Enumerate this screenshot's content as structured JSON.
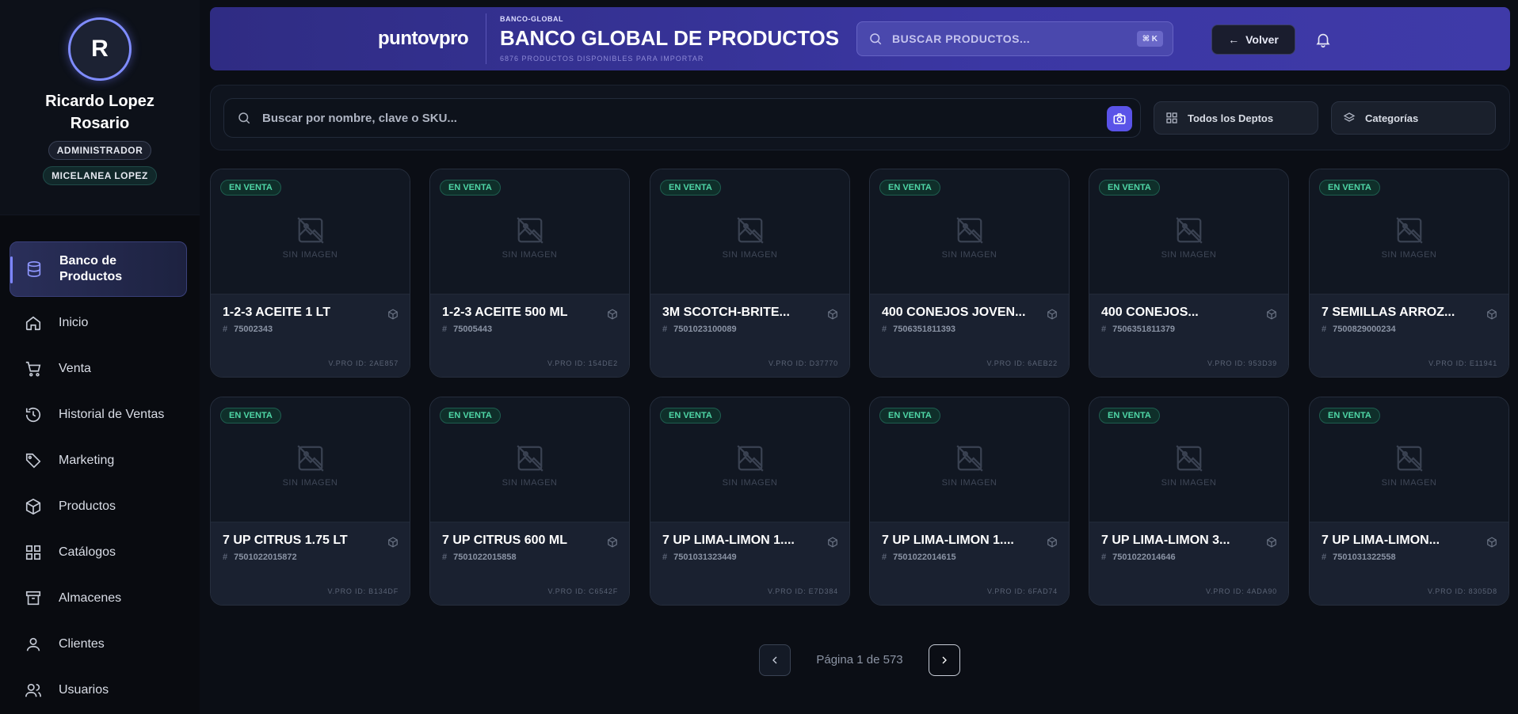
{
  "user": {
    "initial": "R",
    "name": "Ricardo Lopez Rosario",
    "role": "ADMINISTRADOR",
    "store": "MICELANEA LOPEZ"
  },
  "nav": [
    {
      "label": "Banco de Productos",
      "icon": "database-icon",
      "active": true
    },
    {
      "label": "Inicio",
      "icon": "home-icon"
    },
    {
      "label": "Venta",
      "icon": "cart-icon"
    },
    {
      "label": "Historial de Ventas",
      "icon": "history-icon"
    },
    {
      "label": "Marketing",
      "icon": "tag-icon"
    },
    {
      "label": "Productos",
      "icon": "box-icon"
    },
    {
      "label": "Catálogos",
      "icon": "grid-icon"
    },
    {
      "label": "Almacenes",
      "icon": "archive-icon"
    },
    {
      "label": "Clientes",
      "icon": "user-icon"
    },
    {
      "label": "Usuarios",
      "icon": "users-icon"
    }
  ],
  "header": {
    "brand": "puntovpro",
    "breadcrumb": "BANCO-GLOBAL",
    "title": "BANCO GLOBAL DE PRODUCTOS",
    "subtitle": "6876 PRODUCTOS DISPONIBLES PARA IMPORTAR",
    "search_placeholder": "BUSCAR PRODUCTOS...",
    "shortcut": "⌘ K",
    "back_label": "Volver"
  },
  "filters": {
    "search_placeholder": "Buscar por nombre, clave o SKU...",
    "department": "Todos los Deptos",
    "category": "Categorías"
  },
  "placeholder_text": "SIN IMAGEN",
  "products": [
    {
      "status": "EN VENTA",
      "name": "1-2-3 ACEITE 1 LT",
      "sku": "75002343",
      "vpro": "V.PRO ID: 2AE857"
    },
    {
      "status": "EN VENTA",
      "name": "1-2-3 ACEITE 500 ML",
      "sku": "75005443",
      "vpro": "V.PRO ID: 154DE2"
    },
    {
      "status": "EN VENTA",
      "name": "3M SCOTCH-BRITE...",
      "sku": "7501023100089",
      "vpro": "V.PRO ID: D37770"
    },
    {
      "status": "EN VENTA",
      "name": "400 CONEJOS JOVEN...",
      "sku": "7506351811393",
      "vpro": "V.PRO ID: 6AEB22"
    },
    {
      "status": "EN VENTA",
      "name": "400 CONEJOS...",
      "sku": "7506351811379",
      "vpro": "V.PRO ID: 953D39"
    },
    {
      "status": "EN VENTA",
      "name": "7 SEMILLAS ARROZ...",
      "sku": "7500829000234",
      "vpro": "V.PRO ID: E11941"
    },
    {
      "status": "EN VENTA",
      "name": "7 UP CITRUS 1.75 LT",
      "sku": "7501022015872",
      "vpro": "V.PRO ID: B134DF"
    },
    {
      "status": "EN VENTA",
      "name": "7 UP CITRUS 600 ML",
      "sku": "7501022015858",
      "vpro": "V.PRO ID: C6542F"
    },
    {
      "status": "EN VENTA",
      "name": "7 UP LIMA-LIMON 1....",
      "sku": "7501031323449",
      "vpro": "V.PRO ID: E7D384"
    },
    {
      "status": "EN VENTA",
      "name": "7 UP LIMA-LIMON 1....",
      "sku": "7501022014615",
      "vpro": "V.PRO ID: 6FAD74"
    },
    {
      "status": "EN VENTA",
      "name": "7 UP LIMA-LIMON 3...",
      "sku": "7501022014646",
      "vpro": "V.PRO ID: 4ADA90"
    },
    {
      "status": "EN VENTA",
      "name": "7 UP LIMA-LIMON...",
      "sku": "7501031322558",
      "vpro": "V.PRO ID: 8305D8"
    }
  ],
  "pagination": {
    "text": "Página 1 de 573"
  },
  "colors": {
    "accent": "#5a53e8",
    "header": "#3b37a3",
    "status": "#4fd6a6"
  }
}
